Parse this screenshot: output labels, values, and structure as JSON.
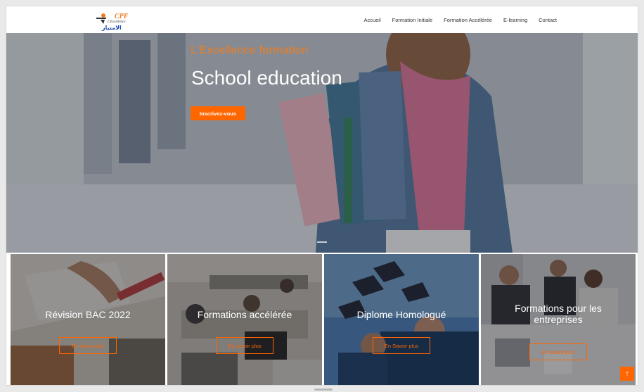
{
  "brand": {
    "name": "L'Excellence",
    "logo_letters": "CPF",
    "logo_arabic": "الامتياز",
    "color_accent": "#ff6600",
    "color_nav_text": "#333333"
  },
  "nav": {
    "items": [
      {
        "label": "Accueil"
      },
      {
        "label": "Formation Initiale"
      },
      {
        "label": "Formation Accélérée"
      },
      {
        "label": "E-learning"
      },
      {
        "label": "Contact"
      }
    ]
  },
  "hero": {
    "subtitle": "L'Excellence formation",
    "title": "School education",
    "button_label": "Inscrivez-vous"
  },
  "cards": [
    {
      "title": "Révision BAC 2022",
      "button_label": "En savoir plus"
    },
    {
      "title": "Formations accélérée",
      "button_label": "En savoir plus"
    },
    {
      "title": "Diplome Homologué",
      "button_label": "En Savoir plus"
    },
    {
      "title": "Formations pour les entreprises",
      "button_label": "En savoir plus"
    }
  ],
  "scroll_top": {
    "icon": "arrow-up-icon",
    "glyph": "↑"
  }
}
